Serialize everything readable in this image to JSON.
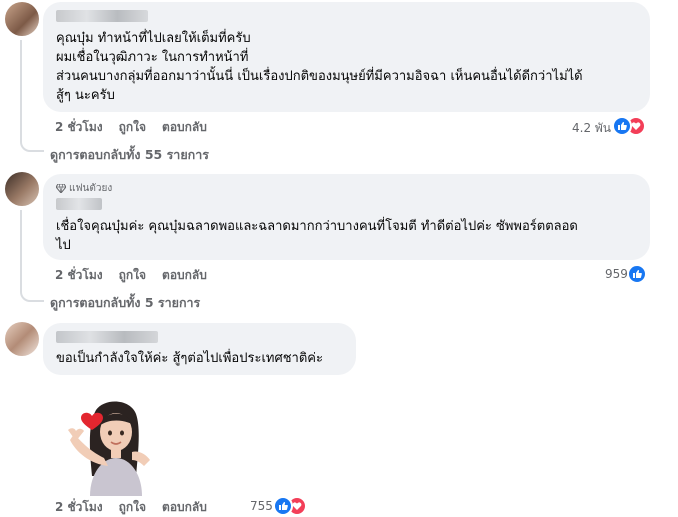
{
  "comments": [
    {
      "text": "คุณบุ๋ม ทำหน้าที่ไปเลยให้เต็มที่ครับ\nผมเชื่อในวุฒิภาวะ ในการทำหน้าที่\nส่วนคนบางกลุ่มที่ออกมาว่านั้นนี่ เป็นเรื่องปกติของมนุษย์ที่มีความอิจฉา เห็นคนอื่นได้ดีกว่าไม่ได้\nสู้ๆ นะครับ",
      "time": "2 ชั่วโมง",
      "like": "ถูกใจ",
      "reply": "ตอบกลับ",
      "reaction_count": "4.2 พัน",
      "view_replies": "ดูการตอบกลับทั้ง 55 รายการ",
      "reactions": [
        "like",
        "love"
      ]
    },
    {
      "badge": "แฟนตัวยง",
      "text": "เชื่อใจคุณบุ๋มค่ะ คุณบุ๋มฉลาดพอและฉลาดมากกว่าบางคนที่โจมตี ทำดีต่อไปค่ะ ซัพพอร์ตตลอด\nไป",
      "time": "2 ชั่วโมง",
      "like": "ถูกใจ",
      "reply": "ตอบกลับ",
      "reaction_count": "959",
      "view_replies": "ดูการตอบกลับทั้ง 5 รายการ",
      "reactions": [
        "like"
      ]
    },
    {
      "text": "ขอเป็นกำลังใจให้ค่ะ สู้ๆต่อไปเพื่อประเทศชาติค่ะ",
      "time": "2 ชั่วโมง",
      "like": "ถูกใจ",
      "reply": "ตอบกลับ",
      "reaction_count": "755",
      "sticker": "avatar-heart-sticker",
      "reactions": [
        "like",
        "love"
      ]
    }
  ],
  "colors": {
    "bubble": "#f0f2f5",
    "secondary_text": "#65676b",
    "like_blue": "#1877f2",
    "love_red": "#f33e58"
  }
}
